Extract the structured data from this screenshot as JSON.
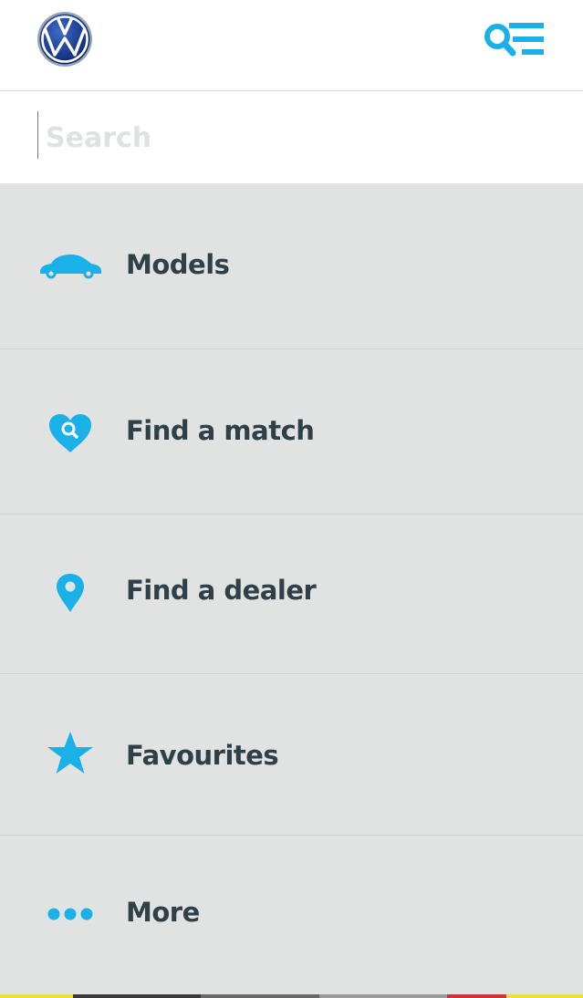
{
  "header": {
    "logo": "vw-logo-icon",
    "menu_icon": "search-menu-icon"
  },
  "search": {
    "placeholder": "Search",
    "value": ""
  },
  "nav": {
    "items": [
      {
        "label": "Models",
        "icon": "car-icon"
      },
      {
        "label": "Find a match",
        "icon": "heart-search-icon"
      },
      {
        "label": "Find a dealer",
        "icon": "location-pin-icon"
      },
      {
        "label": "Favourites",
        "icon": "star-icon"
      },
      {
        "label": "More",
        "icon": "more-dots-icon"
      }
    ]
  },
  "colors": {
    "accent": "#1ab0e8",
    "text": "#2f4048",
    "background": "#e1e3e3",
    "logo_blue": "#1c3f94"
  }
}
